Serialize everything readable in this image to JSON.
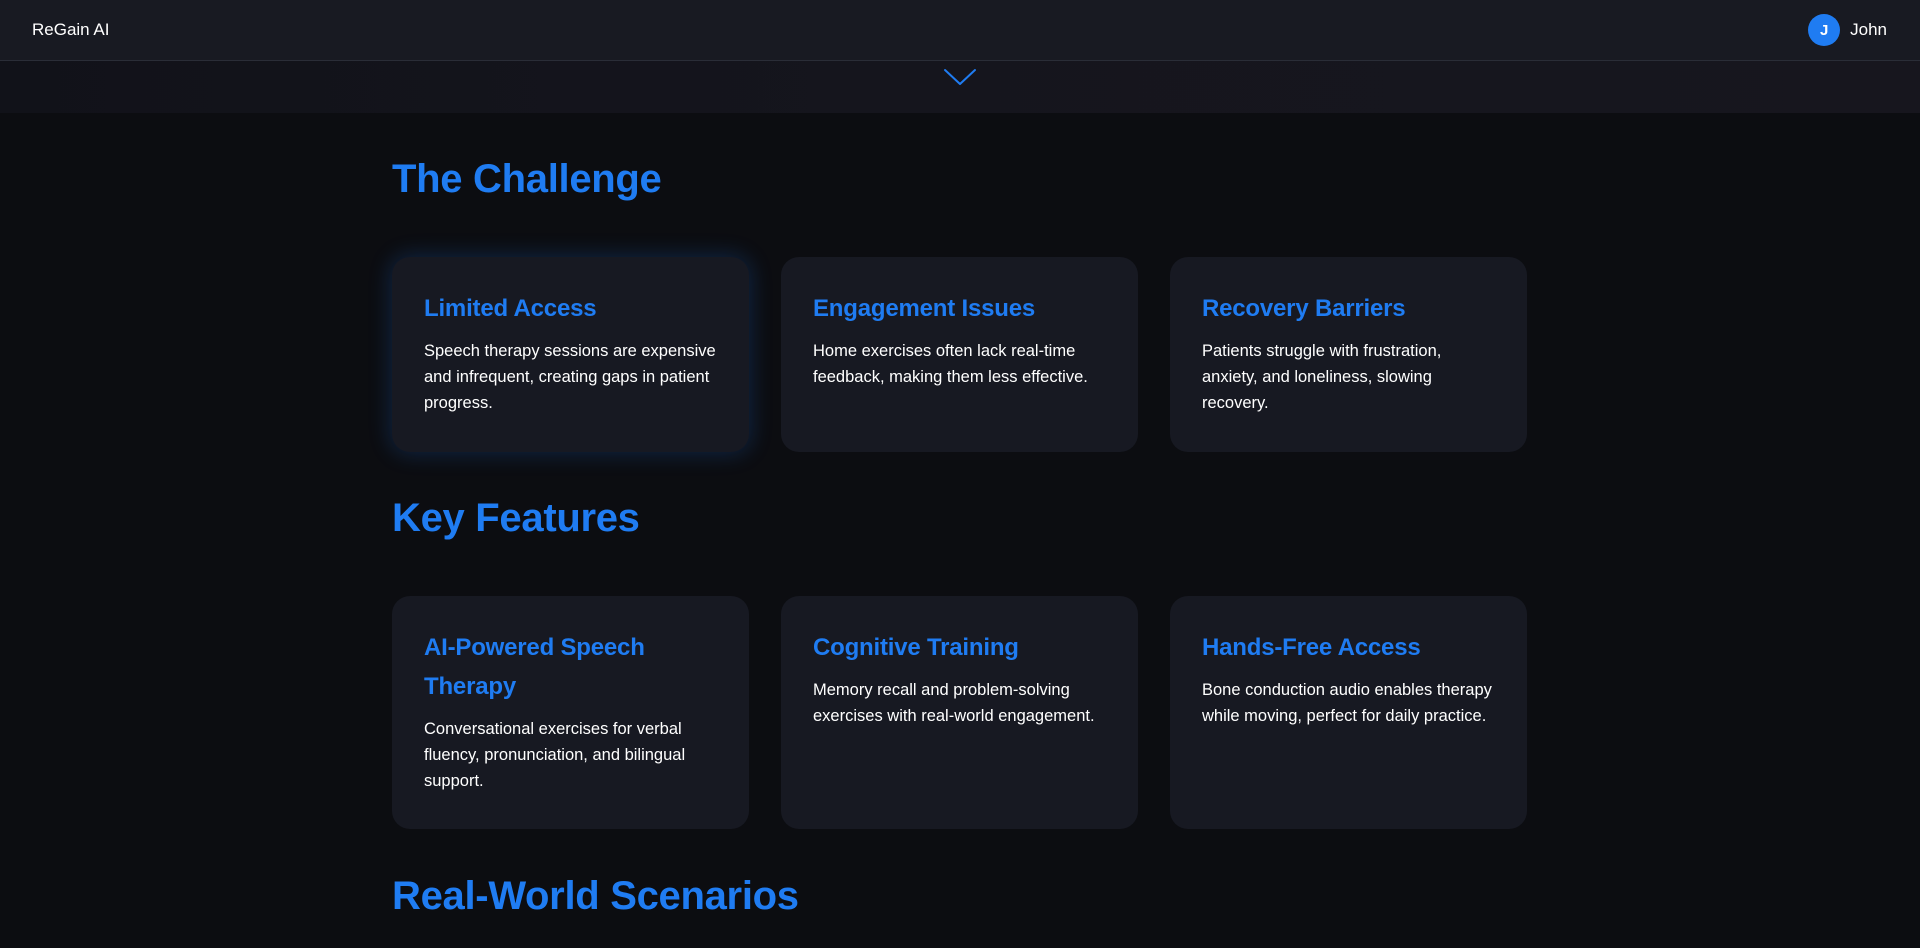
{
  "header": {
    "brand": "ReGain AI",
    "user": {
      "initial": "J",
      "name": "John"
    }
  },
  "icons": {
    "scroll_indicator": "chevron-down-icon",
    "accent_color": "#1f7cf2"
  },
  "challenge": {
    "title": "The Challenge",
    "cards": [
      {
        "title": "Limited Access",
        "text": "Speech therapy sessions are expensive and infrequent, creating gaps in patient progress."
      },
      {
        "title": "Engagement Issues",
        "text": "Home exercises often lack real-time feedback, making them less effective."
      },
      {
        "title": "Recovery Barriers",
        "text": "Patients struggle with frustration, anxiety, and loneliness, slowing recovery."
      }
    ]
  },
  "features": {
    "title": "Key Features",
    "cards": [
      {
        "title": "AI-Powered Speech Therapy",
        "text": "Conversational exercises for verbal fluency, pronunciation, and bilingual support."
      },
      {
        "title": "Cognitive Training",
        "text": "Memory recall and problem-solving exercises with real-world engagement."
      },
      {
        "title": "Hands-Free Access",
        "text": "Bone conduction audio enables therapy while moving, perfect for daily practice."
      }
    ]
  },
  "scenarios": {
    "title": "Real-World Scenarios"
  }
}
